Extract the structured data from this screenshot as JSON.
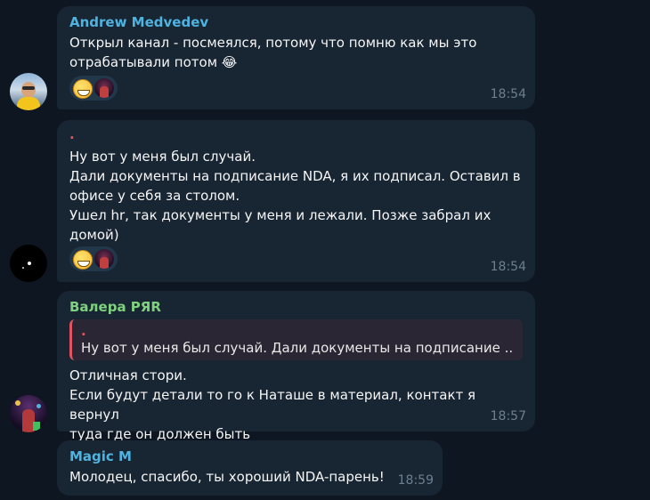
{
  "messages": [
    {
      "sender": "Andrew Medvedev",
      "sender_color": "#4fb3e0",
      "text": "Открыл канал - посмеялся, потому что помню как мы это\nотрабатывали потом 😂",
      "reaction_emoji": "grinning-face",
      "time": "18:54"
    },
    {
      "sender": ".",
      "sender_color": "#e05561",
      "text": "Ну вот у меня был случай.\nДали документы на подписание NDA, я их подписал. Оставил в\nофисе у себя за столом.\nУшел hr, так документы у меня и лежали. Позже забрал их\nдомой)",
      "reaction_emoji": "grinning-face",
      "time": "18:54"
    },
    {
      "sender": "Валера РЯR",
      "sender_color": "#7ed27e",
      "reply": {
        "sender": ".",
        "text": "Ну вот у меня был случай.  Дали документы на подписание ..."
      },
      "text": "Отличная стори.\nЕсли будут детали то го к Наташе в материал, контакт я вернул\nтуда где он должен быть",
      "time": "18:57"
    },
    {
      "sender": "Magic M",
      "sender_color": "#4fb3e0",
      "text": "Молодец, спасибо, ты хороший NDA-парень!",
      "time": "18:59"
    }
  ]
}
